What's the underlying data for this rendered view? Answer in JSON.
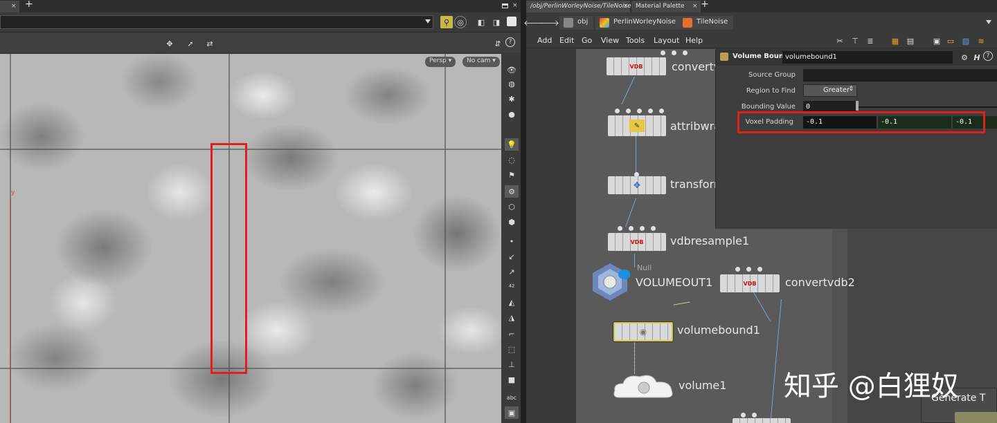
{
  "left_tabs": {
    "close": "×",
    "plus": "+"
  },
  "viewport": {
    "persp": "Persp ▾",
    "cam": "No cam ▾",
    "axis_label": "y"
  },
  "right_tabs": [
    {
      "label": "/obj/PerlinWorleyNoise/TileNoise",
      "close": "×"
    },
    {
      "label": "Material Palette",
      "close": "×"
    },
    {
      "label": "+"
    }
  ],
  "breadcrumbs": [
    "obj",
    "PerlinWorleyNoise",
    "TileNoise"
  ],
  "menu": [
    "Add",
    "Edit",
    "Go",
    "View",
    "Tools",
    "Layout",
    "Help"
  ],
  "nodes": [
    {
      "name": "convertv",
      "type": "vdb"
    },
    {
      "name": "attribwra",
      "type": "attribwrangle"
    },
    {
      "name": "transform",
      "type": "transform"
    },
    {
      "name": "vdbresample1",
      "type": "vdb"
    },
    {
      "name": "VOLUMEOUT1",
      "type": "null",
      "sub": "Null"
    },
    {
      "name": "convertvdb2",
      "type": "vdb"
    },
    {
      "name": "volumebound1",
      "type": "volumebound"
    },
    {
      "name": "volume1",
      "type": "volume"
    }
  ],
  "node_badge": "VDB",
  "params": {
    "title": "Volume Bound",
    "node_name": "volumebound1",
    "source_group_label": "Source Group",
    "source_group_value": "",
    "region_label": "Region to Find",
    "region_value": "Greater",
    "bounding_label": "Bounding Value",
    "bounding_value": "0",
    "voxel_label": "Voxel Padding",
    "voxel_values": [
      "-0.1",
      "-0.1",
      "-0.1"
    ]
  },
  "partial_button": "Generate T",
  "watermark": "知乎 @白狸奴",
  "colors": {
    "highlight": "#e0201e",
    "selected_node": "#d7c44a",
    "wire": "#7ea4c8"
  }
}
